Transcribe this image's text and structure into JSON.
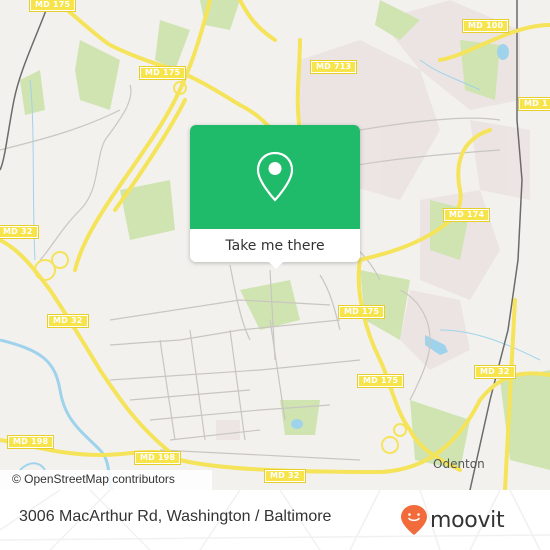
{
  "map": {
    "road_labels": [
      {
        "id": "md175-top",
        "text": "MD 175"
      },
      {
        "id": "md175-mid",
        "text": "MD 175"
      },
      {
        "id": "md713",
        "text": "MD 713"
      },
      {
        "id": "md100",
        "text": "MD 100"
      },
      {
        "id": "md1xx-right",
        "text": "MD 1"
      },
      {
        "id": "md174",
        "text": "MD 174"
      },
      {
        "id": "md32-left",
        "text": "MD 32"
      },
      {
        "id": "md32-mid",
        "text": "MD 32"
      },
      {
        "id": "md175-east1",
        "text": "MD 175"
      },
      {
        "id": "md175-east2",
        "text": "MD 175"
      },
      {
        "id": "md32-east",
        "text": "MD 32"
      },
      {
        "id": "md198-left",
        "text": "MD 198"
      },
      {
        "id": "md198-mid",
        "text": "MD 198"
      },
      {
        "id": "md32-bottom",
        "text": "MD 32"
      }
    ],
    "place_labels": {
      "odenton": "Odenton"
    },
    "attribution": "© OpenStreetMap contributors",
    "colors": {
      "land": "#f2f1ee",
      "park": "#cfe4b0",
      "urban": "#ebe3e1",
      "water": "#9fd3ec",
      "highway": "#f5e35a",
      "road": "#c9c6c1",
      "railway": "#6b6b6b"
    }
  },
  "popup": {
    "icon": "map-pin-icon",
    "button_label": "Take me there",
    "accent": "#1fba6a"
  },
  "footer": {
    "address": "3006 MacArthur Rd, Washington / Baltimore",
    "logo_text": "moovit",
    "logo_icon": "moovit-pin-icon",
    "logo_color": "#f26b3a"
  }
}
